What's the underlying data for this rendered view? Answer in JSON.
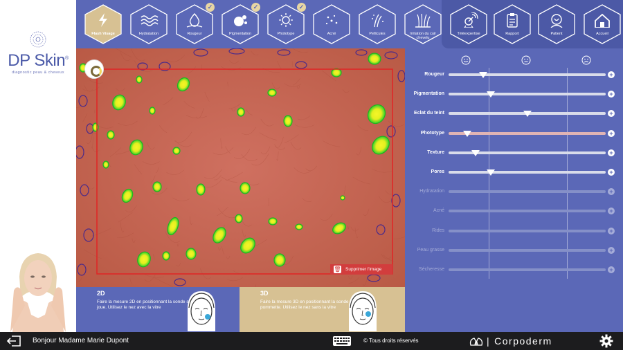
{
  "logo": {
    "name": "DP Skin",
    "trademark": "®",
    "tagline": "diagnostic peau & cheveux"
  },
  "nav": {
    "items": [
      {
        "label": "Flash Visage",
        "icon": "flash-icon",
        "active": true,
        "checked": false
      },
      {
        "label": "Hydratation",
        "icon": "water-waves-icon",
        "active": false,
        "checked": false
      },
      {
        "label": "Rougeur",
        "icon": "redness-drop-icon",
        "active": false,
        "checked": true
      },
      {
        "label": "Pigmentation",
        "icon": "pigmentation-icon",
        "active": false,
        "checked": true
      },
      {
        "label": "Phototype",
        "icon": "sun-icon",
        "active": false,
        "checked": true
      },
      {
        "label": "Acné",
        "icon": "acne-dots-icon",
        "active": false,
        "checked": false
      },
      {
        "label": "Pellicules",
        "icon": "dandruff-icon",
        "active": false,
        "checked": false
      },
      {
        "label": "Irritation du cuir chevelu",
        "icon": "scalp-irritation-icon",
        "active": false,
        "checked": false
      },
      {
        "label": "Téléexpertise",
        "icon": "satellite-icon",
        "active": false,
        "checked": false
      },
      {
        "label": "Rapport",
        "icon": "report-clipboard-icon",
        "active": false,
        "checked": false
      },
      {
        "label": "Patient",
        "icon": "patient-head-icon",
        "active": false,
        "checked": false
      },
      {
        "label": "Accueil",
        "icon": "home-icon",
        "active": false,
        "checked": false
      }
    ]
  },
  "image_view": {
    "delete_label": "Supprimer l'image"
  },
  "measure": {
    "d2": {
      "title": "2D",
      "text": "Faire la mesure 2D en positionnant la sonde sur la joue. Utilisez le nez avec la vitre"
    },
    "d3": {
      "title": "3D",
      "text": "Faire la mesure 3D en positionnant la sonde sur la pommette. Utilisez le nez sans la vitre"
    }
  },
  "sliders": [
    {
      "label": "Rougeur",
      "value": 0.22,
      "enabled": true,
      "pink": false
    },
    {
      "label": "Pigmentation",
      "value": 0.27,
      "enabled": true,
      "pink": false
    },
    {
      "label": "Eclat du teint",
      "value": 0.5,
      "enabled": true,
      "pink": false
    },
    {
      "label": "Phototype",
      "value": 0.12,
      "enabled": true,
      "pink": true
    },
    {
      "label": "Texture",
      "value": 0.17,
      "enabled": true,
      "pink": false
    },
    {
      "label": "Pores",
      "value": 0.27,
      "enabled": true,
      "pink": false
    },
    {
      "label": "Hydratation",
      "value": null,
      "enabled": false,
      "pink": false
    },
    {
      "label": "Acné",
      "value": null,
      "enabled": false,
      "pink": false
    },
    {
      "label": "Rides",
      "value": null,
      "enabled": false,
      "pink": false
    },
    {
      "label": "Peau grasse",
      "value": null,
      "enabled": false,
      "pink": false
    },
    {
      "label": "Sécheresse",
      "value": null,
      "enabled": false,
      "pink": false
    }
  ],
  "footer": {
    "greeting": "Bonjour Madame Marie Dupont",
    "copyright": "© Tous droits réservés",
    "brand": "Corpoderm"
  },
  "colors": {
    "primary": "#5b68b7",
    "accent_gold": "#d7c193",
    "delete_red": "#d23d3d",
    "footer": "#1c1c1e",
    "skin": "#c8674f"
  }
}
